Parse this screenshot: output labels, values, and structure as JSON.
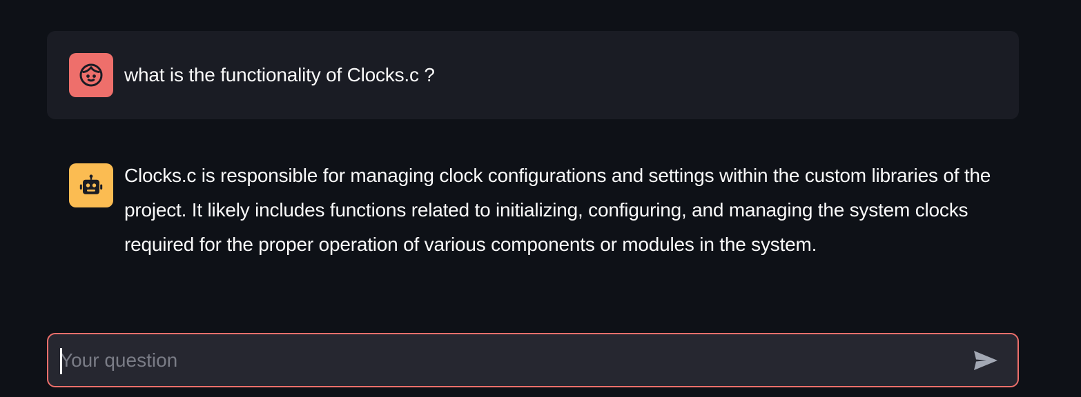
{
  "messages": [
    {
      "role": "user",
      "avatar_icon": "face-icon",
      "avatar_color": "#ee6f6b",
      "text": "what is the functionality of Clocks.c ?"
    },
    {
      "role": "assistant",
      "avatar_icon": "robot-icon",
      "avatar_color": "#fbbc52",
      "text": "Clocks.c is responsible for managing clock configurations and settings within the custom libraries of the project. It likely includes functions related to initializing, configuring, and managing the system clocks required for the proper operation of various components or modules in the system."
    }
  ],
  "chat_input": {
    "placeholder": "Your question",
    "value": "",
    "border_color": "#ee6f6b"
  },
  "send_button": {
    "icon": "send-icon"
  },
  "theme": {
    "background": "#0e1117",
    "user_message_background": "#1a1c24",
    "input_background": "#262730"
  }
}
